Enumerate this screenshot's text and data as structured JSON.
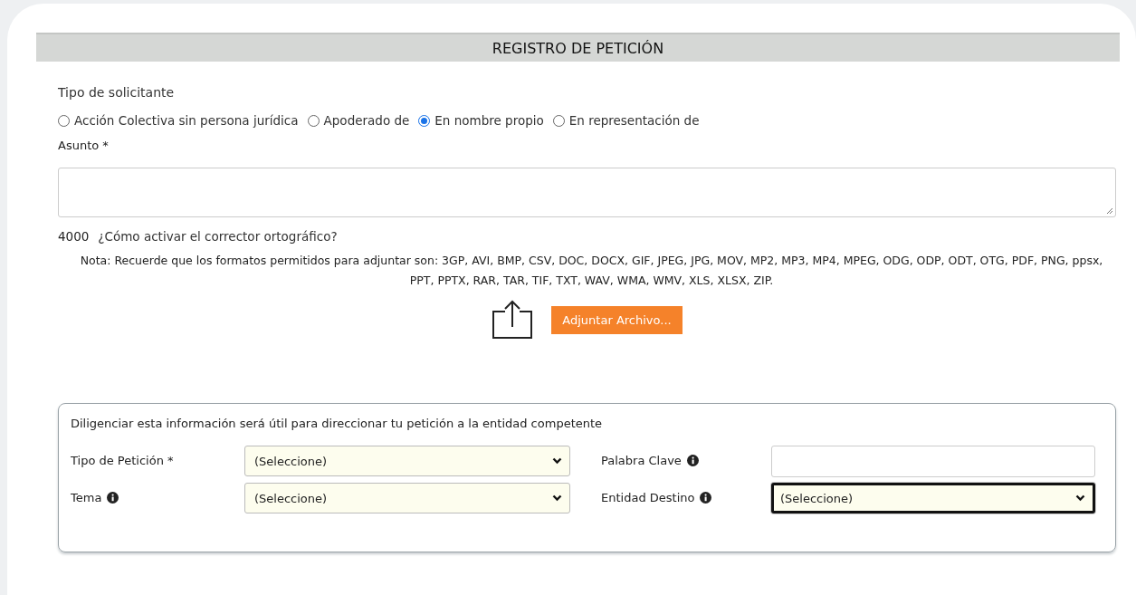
{
  "header": {
    "title": "REGISTRO DE PETICIÓN"
  },
  "applicant_type": {
    "label": "Tipo de solicitante",
    "options": [
      {
        "label": "Acción Colectiva sin persona jurídica",
        "selected": false
      },
      {
        "label": "Apoderado de",
        "selected": false
      },
      {
        "label": "En nombre propio",
        "selected": true
      },
      {
        "label": "En representación de",
        "selected": false
      }
    ]
  },
  "subject": {
    "label": "Asunto *",
    "counter": "4000",
    "spellcheck_link": "¿Cómo activar el corrector ortográfico?"
  },
  "note": "Nota: Recuerde que los formatos permitidos para adjuntar son: 3GP, AVI, BMP, CSV, DOC, DOCX, GIF, JPEG, JPG, MOV, MP2, MP3, MP4, MPEG, ODG, ODP, ODT, OTG, PDF, PNG, ppsx, PPT, PPTX, RAR, TAR, TIF, TXT, WAV, WMA, WMV, XLS, XLSX, ZIP.",
  "attach_button": "Adjuntar Archivo...",
  "routing_panel": {
    "intro": "Diligenciar esta información será útil para direccionar tu petición a la entidad competente",
    "fields": [
      {
        "label": "Tipo de Petición *",
        "kind": "select",
        "value": "(Seleccione)",
        "info": false,
        "focused": false
      },
      {
        "label": "Palabra Clave",
        "kind": "text",
        "info": true,
        "focused": false
      },
      {
        "label": "Tema",
        "kind": "select",
        "value": "(Seleccione)",
        "info": true,
        "focused": false
      },
      {
        "label": "Entidad Destino",
        "kind": "select",
        "value": "(Seleccione)",
        "info": true,
        "focused": true
      }
    ]
  }
}
